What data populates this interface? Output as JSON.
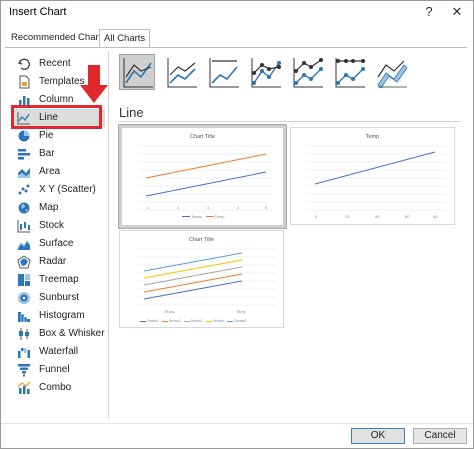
{
  "window": {
    "title": "Insert Chart",
    "help_label": "?",
    "close_label": "✕"
  },
  "tabs": [
    {
      "label": "Recommended Charts"
    },
    {
      "label": "All Charts"
    }
  ],
  "sidebar": {
    "items": [
      {
        "label": "Recent",
        "icon": "recent-icon"
      },
      {
        "label": "Templates",
        "icon": "templates-icon"
      },
      {
        "label": "Column",
        "icon": "column-chart-icon"
      },
      {
        "label": "Line",
        "icon": "line-chart-icon"
      },
      {
        "label": "Pie",
        "icon": "pie-chart-icon"
      },
      {
        "label": "Bar",
        "icon": "bar-chart-icon"
      },
      {
        "label": "Area",
        "icon": "area-chart-icon"
      },
      {
        "label": "X Y (Scatter)",
        "icon": "scatter-chart-icon"
      },
      {
        "label": "Map",
        "icon": "map-chart-icon"
      },
      {
        "label": "Stock",
        "icon": "stock-chart-icon"
      },
      {
        "label": "Surface",
        "icon": "surface-chart-icon"
      },
      {
        "label": "Radar",
        "icon": "radar-chart-icon"
      },
      {
        "label": "Treemap",
        "icon": "treemap-chart-icon"
      },
      {
        "label": "Sunburst",
        "icon": "sunburst-chart-icon"
      },
      {
        "label": "Histogram",
        "icon": "histogram-chart-icon"
      },
      {
        "label": "Box & Whisker",
        "icon": "box-whisker-chart-icon"
      },
      {
        "label": "Waterfall",
        "icon": "waterfall-chart-icon"
      },
      {
        "label": "Funnel",
        "icon": "funnel-chart-icon"
      },
      {
        "label": "Combo",
        "icon": "combo-chart-icon"
      }
    ],
    "selected_index": 3
  },
  "subtypes": {
    "icons": [
      "line-icon",
      "stacked-line-icon",
      "percent-stacked-line-icon",
      "line-with-markers-icon",
      "stacked-line-with-markers-icon",
      "percent-stacked-line-with-markers-icon",
      "3d-line-icon"
    ],
    "selected_index": 0
  },
  "section": {
    "title": "Line"
  },
  "previews": [
    {
      "title": "Chart Title",
      "legend": [
        "Texas",
        "Temp"
      ],
      "x_ticks": [
        "1",
        "2",
        "3",
        "4",
        "5"
      ],
      "colors": [
        "#4472c4",
        "#ed7d31"
      ]
    },
    {
      "title": "Temp",
      "x_ticks": [
        "0",
        "20",
        "40",
        "60",
        "80"
      ],
      "colors": [
        "#4472c4"
      ]
    },
    {
      "title": "Chart Title",
      "legend": [
        "Series1",
        "Series2",
        "Series3",
        "Series4",
        "Series5"
      ],
      "x_ticks": [
        "Texas",
        "Temp"
      ],
      "colors": [
        "#4472c4",
        "#ed7d31",
        "#a5a5a5",
        "#ffc000",
        "#5b9bd5"
      ]
    }
  ],
  "buttons": {
    "ok": "OK",
    "cancel": "Cancel"
  },
  "colors": {
    "highlight": "#e0282d",
    "selected_bg": "#dcdcdc"
  }
}
